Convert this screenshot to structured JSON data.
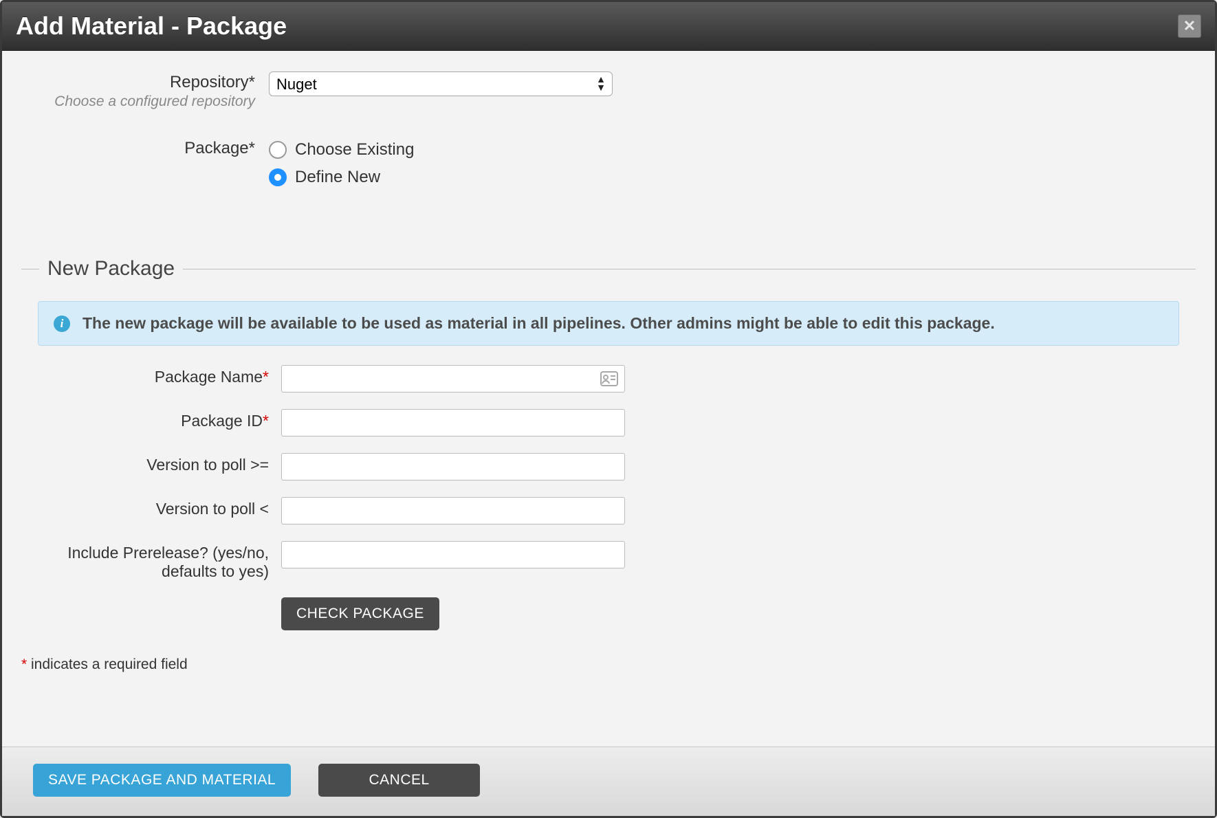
{
  "header": {
    "title": "Add Material - Package"
  },
  "form": {
    "repository": {
      "label": "Repository*",
      "hint": "Choose a configured repository",
      "selected": "Nuget"
    },
    "package": {
      "label": "Package*",
      "options": {
        "existing": "Choose Existing",
        "defineNew": "Define New"
      }
    }
  },
  "newPackage": {
    "legend": "New Package",
    "info": "The new package will be available to be used as material in all pipelines. Other admins might be able to edit this package.",
    "fields": {
      "packageName": {
        "label": "Package Name",
        "required": true,
        "value": ""
      },
      "packageId": {
        "label": "Package ID",
        "required": true,
        "value": ""
      },
      "versionGte": {
        "label": "Version to poll >=",
        "required": false,
        "value": ""
      },
      "versionLt": {
        "label": "Version to poll <",
        "required": false,
        "value": ""
      },
      "prerelease": {
        "label": "Include Prerelease? (yes/no, defaults to yes)",
        "required": false,
        "value": ""
      }
    },
    "checkButton": "CHECK PACKAGE"
  },
  "requiredNote": "indicates a required field",
  "footer": {
    "save": "SAVE PACKAGE AND MATERIAL",
    "cancel": "CANCEL"
  }
}
